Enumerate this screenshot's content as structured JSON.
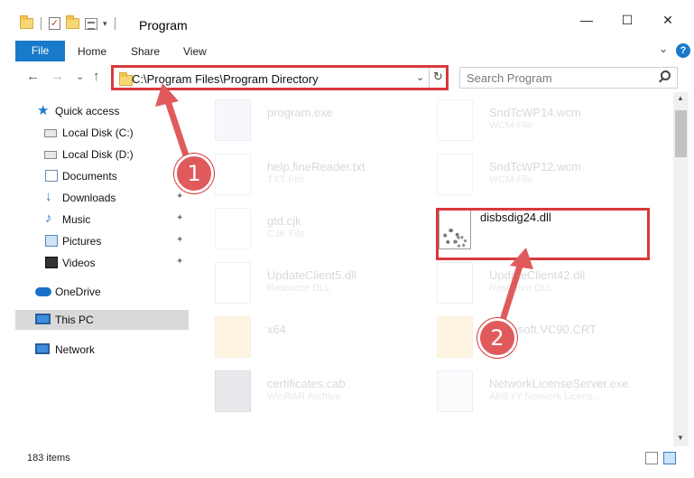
{
  "window": {
    "title": "Program",
    "minimize": "—",
    "maximize": "☐",
    "close": "✕"
  },
  "quick_access_toolbar": {
    "checkmark": "✓",
    "dropdown": "▾"
  },
  "ribbon": {
    "tabs": [
      "File",
      "Home",
      "Share",
      "View"
    ],
    "expand": "⌄",
    "help": "?"
  },
  "nav": {
    "back": "←",
    "forward": "→",
    "recent": "⌄",
    "up": "↑",
    "address": "C:\\Program Files\\Program Directory",
    "address_dropdown": "⌄",
    "refresh": "↻",
    "search_placeholder": "Search Program"
  },
  "sidebar": {
    "items": [
      {
        "label": "Quick access",
        "icon": "star-icon",
        "pinned": false
      },
      {
        "label": "Local Disk (C:)",
        "icon": "drive-icon",
        "pinned": false
      },
      {
        "label": "Local Disk (D:)",
        "icon": "drive-icon",
        "pinned": false
      },
      {
        "label": "Documents",
        "icon": "documents-icon",
        "pinned": false
      },
      {
        "label": "Downloads",
        "icon": "downloads-icon",
        "pinned": true
      },
      {
        "label": "Music",
        "icon": "music-icon",
        "pinned": true
      },
      {
        "label": "Pictures",
        "icon": "pictures-icon",
        "pinned": true
      },
      {
        "label": "Videos",
        "icon": "videos-icon",
        "pinned": true
      },
      {
        "label": "OneDrive",
        "icon": "onedrive-icon",
        "pinned": false
      },
      {
        "label": "This PC",
        "icon": "pc-icon",
        "pinned": false,
        "selected": true
      },
      {
        "label": "Network",
        "icon": "network-icon",
        "pinned": false
      }
    ],
    "pin_glyph": "📌"
  },
  "files": [
    {
      "name": "program.exe",
      "type": ""
    },
    {
      "name": "SndTcWP14.wcm",
      "type": "WCM File"
    },
    {
      "name": "help.fineReader.txt",
      "type": "TXT File"
    },
    {
      "name": "SndTcWP12.wcm",
      "type": "WCM File"
    },
    {
      "name": "gtd.cjk",
      "type": "CJK File"
    },
    {
      "name": "disbsdig24.dll",
      "type": ""
    },
    {
      "name": "UpdateClient5.dll",
      "type": "Resource DLL"
    },
    {
      "name": "UpdateClient42.dll",
      "type": "Resource DLL"
    },
    {
      "name": "x64",
      "type": ""
    },
    {
      "name": "Microsoft.VC90.CRT",
      "type": ""
    },
    {
      "name": "certificates.cab",
      "type": "WinRAR Archive"
    },
    {
      "name": "NetworkLicenseServer.exe",
      "type": "ABBYY Network Licens..."
    }
  ],
  "annotations": {
    "step1": "1",
    "step2": "2",
    "highlight_color": "#d9393c"
  },
  "status": {
    "item_count": "183 items"
  },
  "colors": {
    "accent": "#1979ca",
    "selection": "#d9d9d9"
  }
}
